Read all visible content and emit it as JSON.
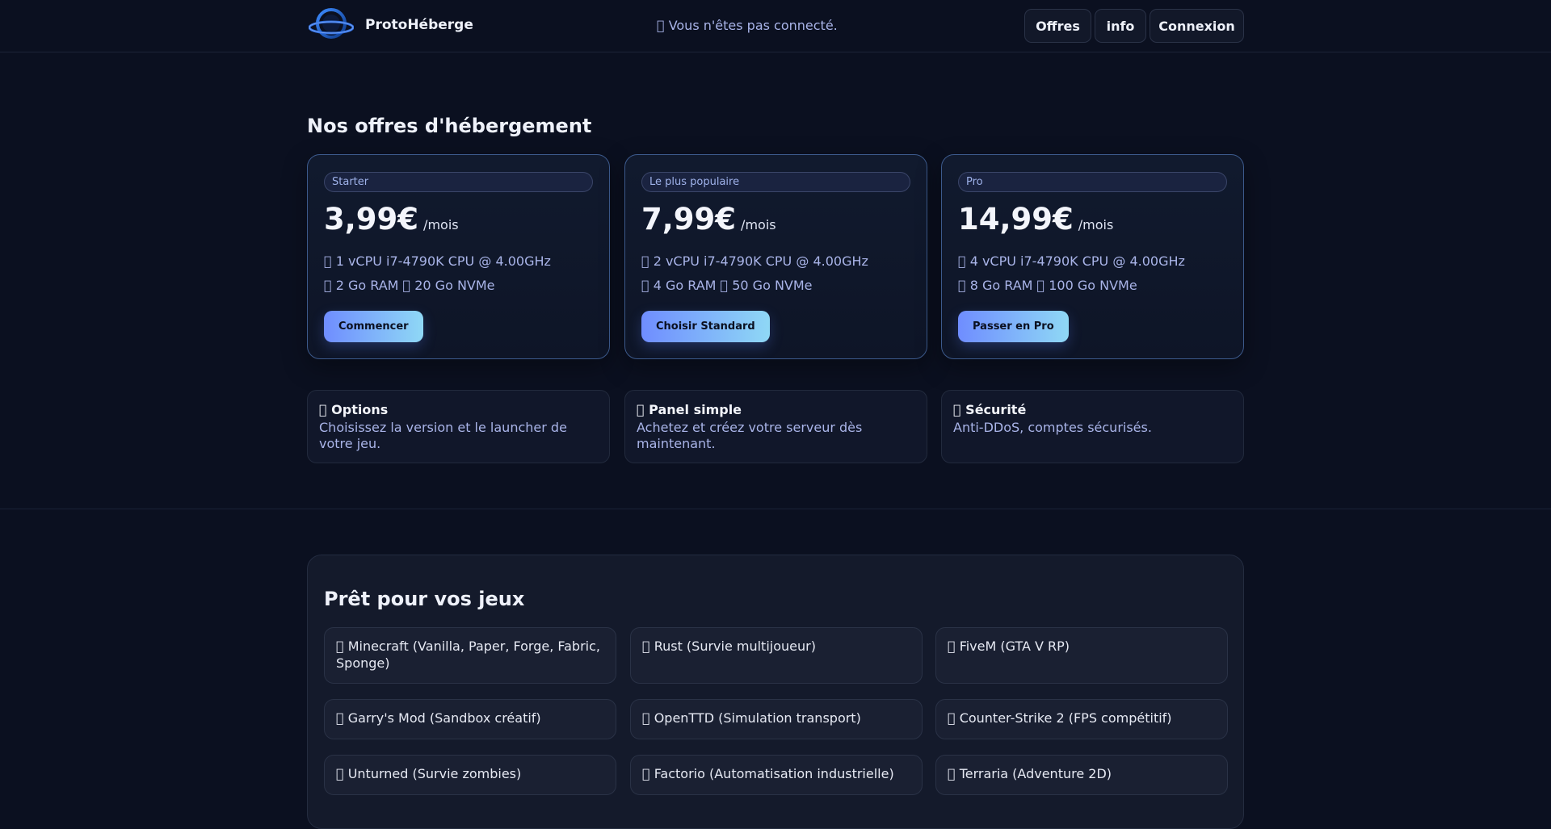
{
  "header": {
    "brand": "ProtoHéberge",
    "status": "\u0000 Vous n'êtes pas connecté.",
    "nav": [
      {
        "label": "Offres"
      },
      {
        "label": "info"
      },
      {
        "label": "Connexion"
      }
    ],
    "logo_icon": "planet-ring-logo"
  },
  "offers": {
    "title": "Nos offres d'hébergement",
    "plans": [
      {
        "tag": "Starter",
        "price": "3,99€",
        "per": "/mois",
        "cpu": "\u0000 1 vCPU i7-4790K CPU @ 4.00GHz",
        "storage": "\u0000 2 Go RAM \u0000 20 Go NVMe",
        "cta": "Commencer"
      },
      {
        "tag": "Le plus populaire",
        "price": "7,99€",
        "per": "/mois",
        "cpu": "\u0000 2 vCPU i7-4790K CPU @ 4.00GHz",
        "storage": "\u0000 4 Go RAM \u0000 50 Go NVMe",
        "cta": "Choisir Standard"
      },
      {
        "tag": "Pro",
        "price": "14,99€",
        "per": "/mois",
        "cpu": "\u0000 4 vCPU i7-4790K CPU @ 4.00GHz",
        "storage": "\u0000 8 Go RAM \u0000 100 Go NVMe",
        "cta": "Passer en Pro"
      }
    ]
  },
  "features": [
    {
      "title": "\u0000 Options",
      "desc": "Choisissez la version et le launcher de votre jeu."
    },
    {
      "title": "\u0000 Panel simple",
      "desc": "Achetez et créez votre serveur dès maintenant."
    },
    {
      "title": "\u0000 Sécurité",
      "desc": "Anti-DDoS, comptes sécurisés."
    }
  ],
  "games": {
    "title": "Prêt pour vos jeux",
    "items": [
      "\u0000 Minecraft (Vanilla, Paper, Forge, Fabric, Sponge)",
      "\u0000 Rust (Survie multijoueur)",
      "\u0000 FiveM (GTA V RP)",
      "\u0000 Garry's Mod (Sandbox créatif)",
      "\u0000 OpenTTD (Simulation transport)",
      "\u0000 Counter-Strike 2 (FPS compétitif)",
      "\u0000 Unturned (Survie zombies)",
      "\u0000 Factorio (Automatisation industrielle)",
      "\u0000 Terraria (Adventure 2D)"
    ]
  },
  "colors": {
    "background": "#0b1020",
    "accent_gradient_start": "#6f8dff",
    "accent_gradient_end": "#8fd8f5",
    "muted_text": "#a9b4e8"
  }
}
